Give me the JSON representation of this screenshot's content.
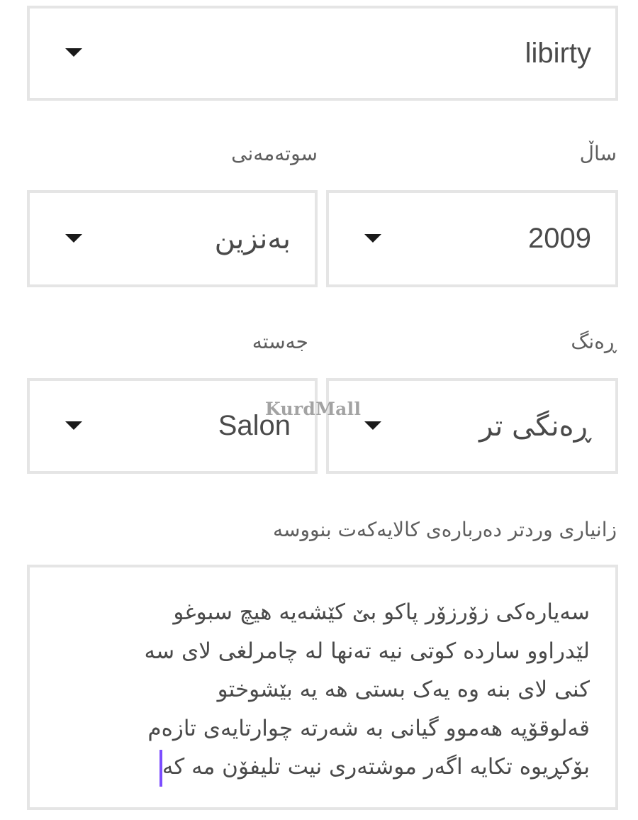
{
  "brand_select": {
    "value": "libirty"
  },
  "year_label": "ساڵ",
  "fuel_label": "سوتەمەنی",
  "year_select": {
    "value": "2009"
  },
  "fuel_select": {
    "value": "بەنزین"
  },
  "color_label": "ڕەنگ",
  "body_label": "جەستە",
  "color_select": {
    "value": "ڕەنگی تر"
  },
  "body_select": {
    "value": "Salon"
  },
  "watermark": "KurdMall",
  "description_label": "زانیاری وردتر دەربارەی کالایەکەت بنووسە",
  "description": {
    "lines": [
      "سەیارەکی زۆرزۆر پاکو بێ کێشەیە هیچ سبوغو",
      "لێدراوو ساردە کوتی نیە تەنها لە چامرلغی لای سە",
      "کنی لای بنە وە یەک بستی هە یە بێشوختو",
      "قەلوقۆپە هەموو گیانی بە شەرتە چوارتایەی تازەم",
      "بۆکڕیوە تکایە اگەر موشتەری نیت تلیفۆن مە کە"
    ]
  },
  "colors": {
    "border": "#e5e5e5",
    "caret": "#7c4dff",
    "text": "#4a4a4a",
    "label": "#5f5f5f"
  },
  "icons": {
    "dropdown": "caret-down-icon"
  }
}
